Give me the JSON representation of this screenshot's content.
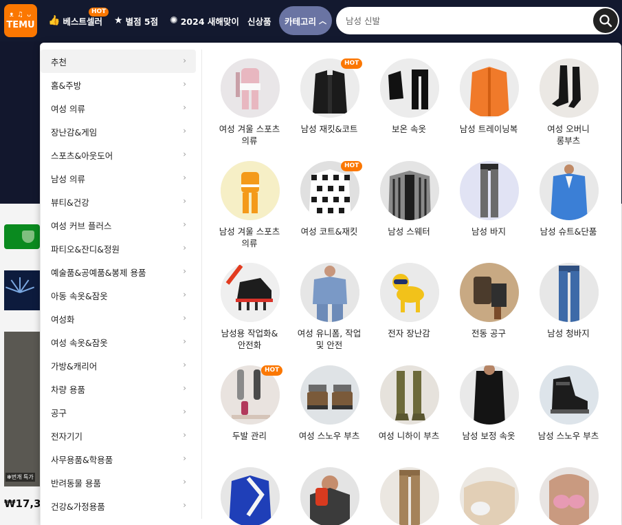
{
  "nav": {
    "logo_mark": "ᴥ ♫ ᴗ",
    "logo_text": "TEMU",
    "items": [
      {
        "label": "베스트셀러",
        "icon": "thumbs-up-icon",
        "hot": "HOT"
      },
      {
        "label": "별점 5점",
        "icon": "star-box-icon"
      },
      {
        "label": "2024 새해맞이",
        "icon": "firework-icon"
      },
      {
        "label": "신상품"
      }
    ],
    "category_button": "카테고리",
    "search_placeholder": "남성 신발"
  },
  "background": {
    "promo_tag": "✻번개 특가",
    "price": "₩17,3"
  },
  "sidebar": {
    "items": [
      {
        "label": "추천"
      },
      {
        "label": "홈&주방"
      },
      {
        "label": "여성 의류"
      },
      {
        "label": "장난감&게임"
      },
      {
        "label": "스포츠&아웃도어"
      },
      {
        "label": "남성 의류"
      },
      {
        "label": "뷰티&건강"
      },
      {
        "label": "여성 커브 플러스"
      },
      {
        "label": "파티오&잔디&정원"
      },
      {
        "label": "예술품&공예품&봉제 용품"
      },
      {
        "label": "아동 속옷&잠옷"
      },
      {
        "label": "여성화"
      },
      {
        "label": "여성 속옷&잠옷"
      },
      {
        "label": "가방&캐리어"
      },
      {
        "label": "차량 용품"
      },
      {
        "label": "공구"
      },
      {
        "label": "전자기기"
      },
      {
        "label": "사무용품&학용품"
      },
      {
        "label": "반려동물 용품"
      },
      {
        "label": "건강&가정용품"
      }
    ]
  },
  "tiles": [
    {
      "label": "여성 겨울 스포츠 의류",
      "hot": ""
    },
    {
      "label": "남성 재킷&코트",
      "hot": "HOT"
    },
    {
      "label": "보온 속옷",
      "hot": ""
    },
    {
      "label": "남성 트레이닝복",
      "hot": ""
    },
    {
      "label": "여성 오버니 롱부츠",
      "hot": ""
    },
    {
      "label": "남성 겨울 스포츠 의류",
      "hot": ""
    },
    {
      "label": "여성 코트&재킷",
      "hot": "HOT"
    },
    {
      "label": "남성 스웨터",
      "hot": ""
    },
    {
      "label": "남성 바지",
      "hot": ""
    },
    {
      "label": "남성 슈트&단품",
      "hot": ""
    },
    {
      "label": "남성용 작업화&안전화",
      "hot": ""
    },
    {
      "label": "여성 유니폼, 작업 및 안전",
      "hot": ""
    },
    {
      "label": "전자 장난감",
      "hot": ""
    },
    {
      "label": "전동 공구",
      "hot": ""
    },
    {
      "label": "남성 청바지",
      "hot": ""
    },
    {
      "label": "두발 관리",
      "hot": "HOT"
    },
    {
      "label": "여성 스노우 부츠",
      "hot": ""
    },
    {
      "label": "여성 니하이 부츠",
      "hot": ""
    },
    {
      "label": "남성 보정 속옷",
      "hot": ""
    },
    {
      "label": "남성 스노우 부츠",
      "hot": ""
    },
    {
      "label": "",
      "hot": ""
    },
    {
      "label": "",
      "hot": ""
    },
    {
      "label": "",
      "hot": ""
    },
    {
      "label": "",
      "hot": ""
    },
    {
      "label": "",
      "hot": ""
    }
  ],
  "colors": {
    "nav_bg": "#13192f",
    "brand_orange": "#fb7701",
    "category_active": "#6a74a3"
  }
}
